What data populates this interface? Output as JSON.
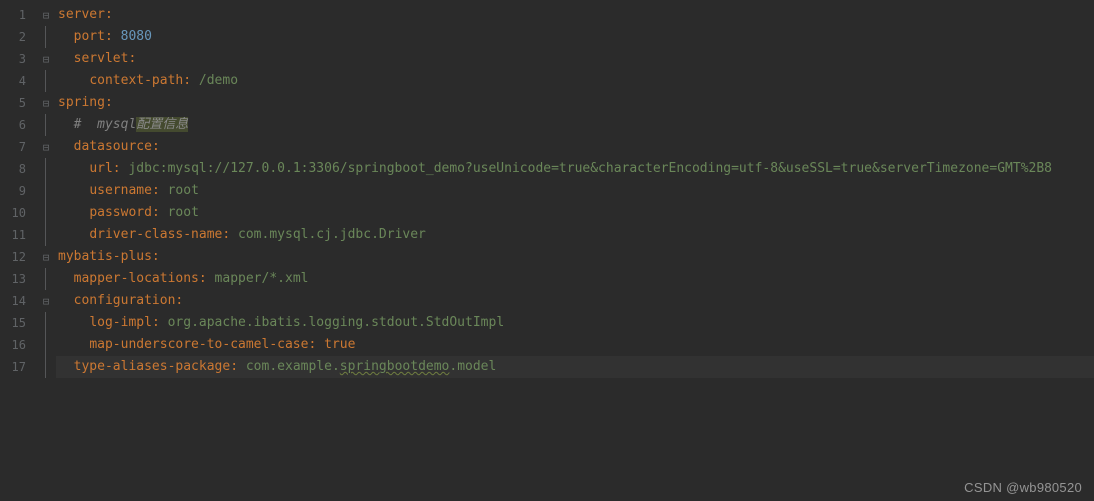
{
  "watermark": "CSDN @wb980520",
  "current_line": 17,
  "lines": [
    {
      "n": 1,
      "fold": "minus",
      "indent": 0,
      "parts": [
        [
          "key",
          "server"
        ],
        [
          "colon",
          ":"
        ]
      ]
    },
    {
      "n": 2,
      "fold": "bar",
      "indent": 1,
      "parts": [
        [
          "key",
          "port"
        ],
        [
          "colon",
          ": "
        ],
        [
          "num",
          "8080"
        ]
      ]
    },
    {
      "n": 3,
      "fold": "minus",
      "indent": 1,
      "parts": [
        [
          "key",
          "servlet"
        ],
        [
          "colon",
          ":"
        ]
      ]
    },
    {
      "n": 4,
      "fold": "bar",
      "indent": 2,
      "parts": [
        [
          "key",
          "context-path"
        ],
        [
          "colon",
          ": "
        ],
        [
          "val",
          "/demo"
        ]
      ]
    },
    {
      "n": 5,
      "fold": "minus",
      "indent": 0,
      "parts": [
        [
          "key",
          "spring"
        ],
        [
          "colon",
          ":"
        ]
      ]
    },
    {
      "n": 6,
      "fold": "bar",
      "indent": 1,
      "parts": [
        [
          "comment",
          "#  mysql"
        ],
        [
          "comment-hl",
          "配置信息"
        ]
      ]
    },
    {
      "n": 7,
      "fold": "minus",
      "indent": 1,
      "parts": [
        [
          "key",
          "datasource"
        ],
        [
          "colon",
          ":"
        ]
      ]
    },
    {
      "n": 8,
      "fold": "bar",
      "indent": 2,
      "parts": [
        [
          "key",
          "url"
        ],
        [
          "colon",
          ": "
        ],
        [
          "val",
          "jdbc:mysql://127.0.0.1:3306/springboot_demo?useUnicode=true&characterEncoding=utf-8&useSSL=true&serverTimezone=GMT%2B8"
        ]
      ]
    },
    {
      "n": 9,
      "fold": "bar",
      "indent": 2,
      "parts": [
        [
          "key",
          "username"
        ],
        [
          "colon",
          ": "
        ],
        [
          "val",
          "root"
        ]
      ]
    },
    {
      "n": 10,
      "fold": "bar",
      "indent": 2,
      "parts": [
        [
          "key",
          "password"
        ],
        [
          "colon",
          ": "
        ],
        [
          "val",
          "root"
        ]
      ]
    },
    {
      "n": 11,
      "fold": "bar",
      "indent": 2,
      "parts": [
        [
          "key",
          "driver-class-name"
        ],
        [
          "colon",
          ": "
        ],
        [
          "val",
          "com.mysql.cj.jdbc.Driver"
        ]
      ]
    },
    {
      "n": 12,
      "fold": "minus",
      "indent": 0,
      "parts": [
        [
          "key",
          "mybatis-plus"
        ],
        [
          "colon",
          ":"
        ]
      ]
    },
    {
      "n": 13,
      "fold": "bar",
      "indent": 1,
      "parts": [
        [
          "key",
          "mapper-locations"
        ],
        [
          "colon",
          ": "
        ],
        [
          "val",
          "mapper/*.xml"
        ]
      ]
    },
    {
      "n": 14,
      "fold": "minus",
      "indent": 1,
      "parts": [
        [
          "key",
          "configuration"
        ],
        [
          "colon",
          ":"
        ]
      ]
    },
    {
      "n": 15,
      "fold": "bar",
      "indent": 2,
      "parts": [
        [
          "key",
          "log-impl"
        ],
        [
          "colon",
          ": "
        ],
        [
          "val",
          "org.apache.ibatis.logging.stdout.StdOutImpl"
        ]
      ]
    },
    {
      "n": 16,
      "fold": "bar",
      "indent": 2,
      "parts": [
        [
          "key",
          "map-underscore-to-camel-case"
        ],
        [
          "colon",
          ": "
        ],
        [
          "bool",
          "true"
        ]
      ]
    },
    {
      "n": 17,
      "fold": "bar",
      "indent": 1,
      "parts": [
        [
          "key",
          "type-aliases-package"
        ],
        [
          "colon",
          ": "
        ],
        [
          "val-squiggle",
          "com.example.springbootdemo.model"
        ]
      ]
    }
  ]
}
